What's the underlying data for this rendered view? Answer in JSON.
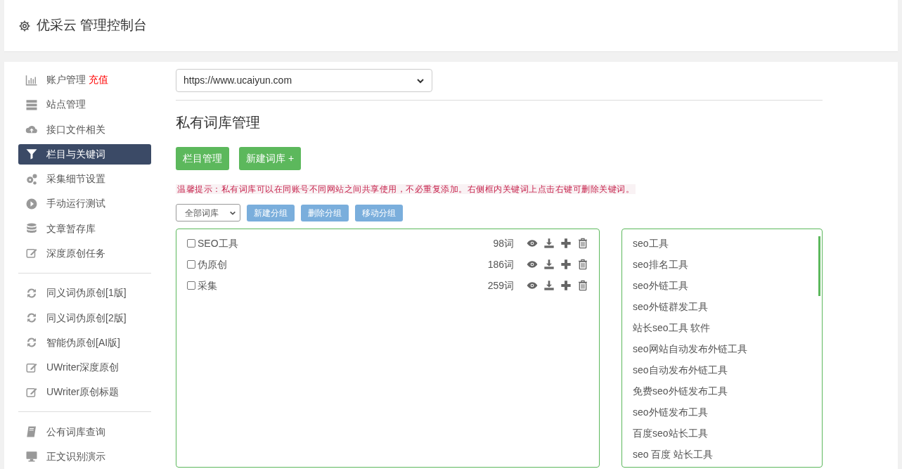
{
  "header": {
    "title": "优采云 管理控制台"
  },
  "sidebar": {
    "groups": [
      [
        {
          "kind": "chart",
          "label": "账户管理",
          "badge": "充值",
          "selected": false
        },
        {
          "kind": "server",
          "label": "站点管理",
          "selected": false
        },
        {
          "kind": "cloud",
          "label": "接口文件相关",
          "selected": false
        },
        {
          "kind": "filter",
          "label": "栏目与关键词",
          "selected": true
        },
        {
          "kind": "gears",
          "label": "采集细节设置",
          "selected": false
        },
        {
          "kind": "play",
          "label": "手动运行测试",
          "selected": false
        },
        {
          "kind": "database",
          "label": "文章暂存库",
          "selected": false
        },
        {
          "kind": "edit",
          "label": "深度原创任务",
          "selected": false
        }
      ],
      [
        {
          "kind": "refresh",
          "label": "同义词伪原创[1版]",
          "selected": false
        },
        {
          "kind": "refresh",
          "label": "同义词伪原创[2版]",
          "selected": false
        },
        {
          "kind": "refresh",
          "label": "智能伪原创[AI版]",
          "selected": false
        },
        {
          "kind": "edit",
          "label": "UWriter深度原创",
          "selected": false
        },
        {
          "kind": "edit",
          "label": "UWriter原创标题",
          "selected": false
        }
      ],
      [
        {
          "kind": "book",
          "label": "公有词库查询",
          "selected": false
        },
        {
          "kind": "monitor",
          "label": "正文识别演示",
          "selected": false
        }
      ]
    ]
  },
  "site_select": {
    "value": "https://www.ucaiyun.com"
  },
  "heading": "私有词库管理",
  "primary_buttons": [
    "栏目管理",
    "新建词库 +"
  ],
  "tip": "温馨提示：私有词库可以在同账号不同网站之间共享使用，不必重复添加。右侧框内关键词上点击右键可删除关键词。",
  "group_select": {
    "value": "全部词库"
  },
  "group_buttons": [
    "新建分组",
    "删除分组",
    "移动分组"
  ],
  "libraries": [
    {
      "name": "SEO工具",
      "count": "98词",
      "checked": false
    },
    {
      "name": "伪原创",
      "count": "186词",
      "checked": false
    },
    {
      "name": "采集",
      "count": "259词",
      "checked": false
    }
  ],
  "keywords": [
    "seo工具",
    "seo排名工具",
    "seo外链工具",
    "seo外链群发工具",
    "站长seo工具 软件",
    "seo网站自动发布外链工具",
    "seo自动发布外链工具",
    "免费seo外链发布工具",
    "seo外链发布工具",
    "百度seo站长工具",
    "seo 百度 站长工具"
  ]
}
